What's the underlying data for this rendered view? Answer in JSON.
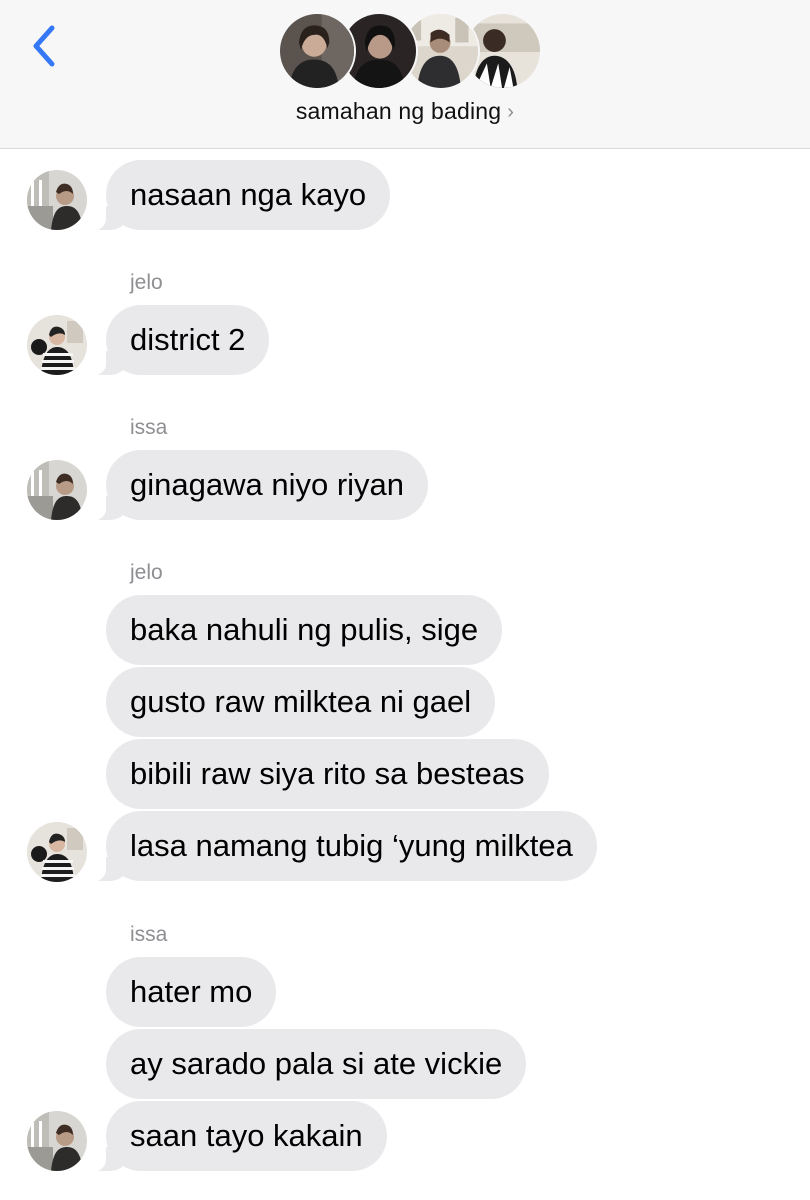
{
  "header": {
    "back_icon": "chevron-left-icon",
    "group_name": "samahan ng bading",
    "chevron": "›",
    "accent_color": "#3478f6",
    "members": [
      "member-1",
      "member-2",
      "member-3",
      "member-4"
    ]
  },
  "messages": [
    {
      "sender": "",
      "text": "nasaan nga kayo",
      "avatar": "issa"
    },
    {
      "sender": "jelo",
      "text": "district 2",
      "avatar": "jelo"
    },
    {
      "sender": "issa",
      "text": "ginagawa niyo riyan",
      "avatar": "issa"
    },
    {
      "sender": "jelo",
      "text": "baka nahuli ng pulis, sige",
      "avatar": ""
    },
    {
      "sender": "",
      "text": "gusto raw milktea ni gael",
      "avatar": ""
    },
    {
      "sender": "",
      "text": "bibili raw siya rito sa besteas",
      "avatar": ""
    },
    {
      "sender": "",
      "text": "lasa namang tubig ‘yung milktea",
      "avatar": "jelo"
    },
    {
      "sender": "issa",
      "text": "hater mo",
      "avatar": ""
    },
    {
      "sender": "",
      "text": "ay sarado pala si ate vickie",
      "avatar": ""
    },
    {
      "sender": "",
      "text": "saan tayo kakain",
      "avatar": "issa"
    }
  ],
  "colors": {
    "incoming_bubble": "#e9e9eb",
    "sender_label": "#8e8e93",
    "header_bg": "#f7f7f7"
  }
}
